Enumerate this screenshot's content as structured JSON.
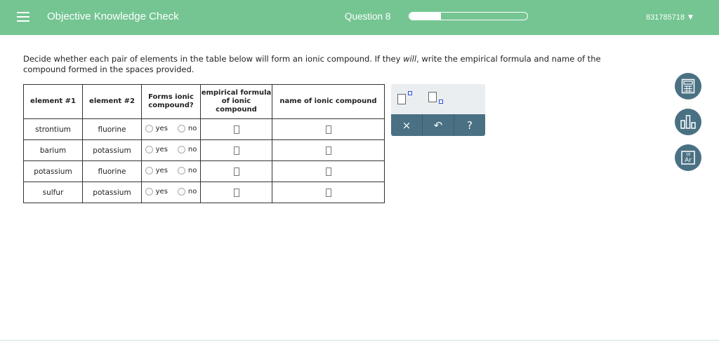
{
  "header": {
    "title": "Objective Knowledge Check",
    "question_label": "Question 8",
    "progress": 0.27,
    "user_id": "831785718",
    "accent_color": "#74c592"
  },
  "instructions": {
    "part1": "Decide whether each pair of elements in the table below will form an ionic compound. If they ",
    "emph": "will",
    "part2": ", write the empirical formula and name of the compound formed in the spaces provided."
  },
  "table": {
    "headers": [
      "element #1",
      "element #2",
      "Forms ionic compound?",
      "empirical formula of ionic compound",
      "name of ionic compound"
    ],
    "yes_label": "yes",
    "no_label": "no",
    "rows": [
      {
        "el1": "strontium",
        "el2": "fluorine"
      },
      {
        "el1": "barium",
        "el2": "potassium"
      },
      {
        "el1": "potassium",
        "el2": "fluorine"
      },
      {
        "el1": "sulfur",
        "el2": "potassium"
      }
    ]
  },
  "palette": {
    "buttons": {
      "clear": "×",
      "undo": "↶",
      "help": "?"
    },
    "icons": [
      "superscript-template-icon",
      "subscript-template-icon",
      "close-icon",
      "undo-icon",
      "help-icon"
    ],
    "button_color": "#4a7083"
  },
  "sidebar_tools": [
    "calculator-icon",
    "bar-chart-icon",
    "periodic-table-icon"
  ],
  "periodic_icon": {
    "number": "18",
    "symbol": "Ar"
  }
}
